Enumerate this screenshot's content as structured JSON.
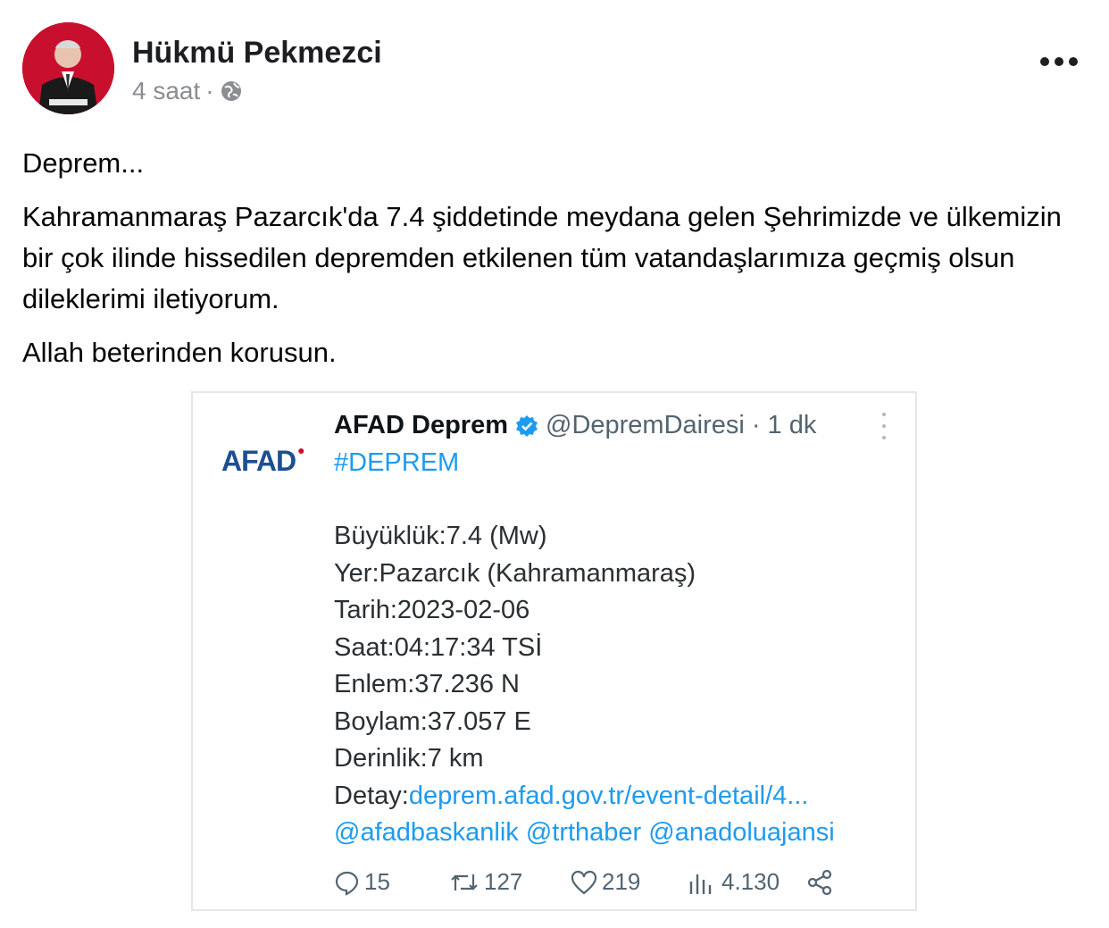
{
  "post": {
    "author": "Hükmü Pekmezci",
    "time": "4 saat",
    "separator": "·",
    "paragraphs": [
      "Deprem...",
      "Kahramanmaraş Pazarcık'da 7.4 şiddetinde meydana gelen Şehrimizde ve ülkemizin bir çok ilinde hissedilen depremden etkilenen tüm vatandaşlarımıza geçmiş olsun dileklerimi iletiyorum.",
      "Allah beterinden korusun."
    ]
  },
  "embed": {
    "logo_text": "AFAD",
    "name": "AFAD Deprem",
    "handle": "@DepremDairesi",
    "time": "· 1 dk",
    "hashtag": "#DEPREM",
    "lines": {
      "magnitude": "Büyüklük:7.4 (Mw)",
      "place": "Yer:Pazarcık (Kahramanmaraş)",
      "date": "Tarih:2023-02-06",
      "hour": "Saat:04:17:34 TSİ",
      "lat": "Enlem:37.236 N",
      "lon": "Boylam:37.057 E",
      "depth": "Derinlik:7 km",
      "detail_label": "Detay:",
      "detail_link": "deprem.afad.gov.tr/event-detail/4...",
      "mentions": "@afadbaskanlik @trthaber @anadoluajansi"
    },
    "stats": {
      "replies": "15",
      "retweets": "127",
      "likes": "219",
      "views": "4.130"
    }
  },
  "colors": {
    "accent": "#1d9bf0",
    "meta": "#8a8d91",
    "afad_blue": "#1d4f91",
    "afad_red": "#c8102e"
  }
}
